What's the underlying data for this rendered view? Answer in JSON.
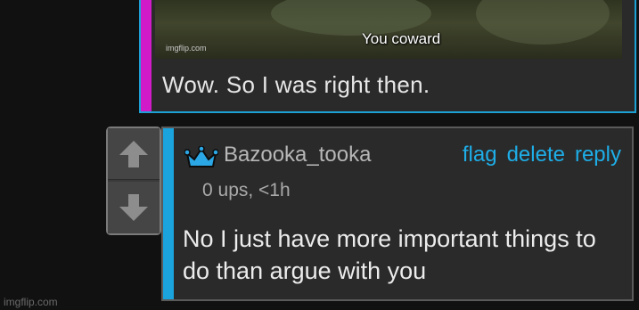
{
  "parent_comment": {
    "meme": {
      "caption": "You coward",
      "watermark": "imgflip.com"
    },
    "text": "Wow. So I was right then."
  },
  "vote": {
    "up_icon": "arrow-up-icon",
    "down_icon": "arrow-down-icon"
  },
  "reply": {
    "user_icon": "crown-icon",
    "username": "Bazooka_tooka",
    "actions": {
      "flag": "flag",
      "delete": "delete",
      "reply": "reply"
    },
    "meta": "0 ups, <1h",
    "text": "No I just have more important things to do than argue with you"
  },
  "site_watermark": "imgflip.com",
  "colors": {
    "parent_accent": "#d11ac8",
    "reply_accent": "#1aa3dc",
    "link": "#1eaee8",
    "background": "#111111"
  }
}
